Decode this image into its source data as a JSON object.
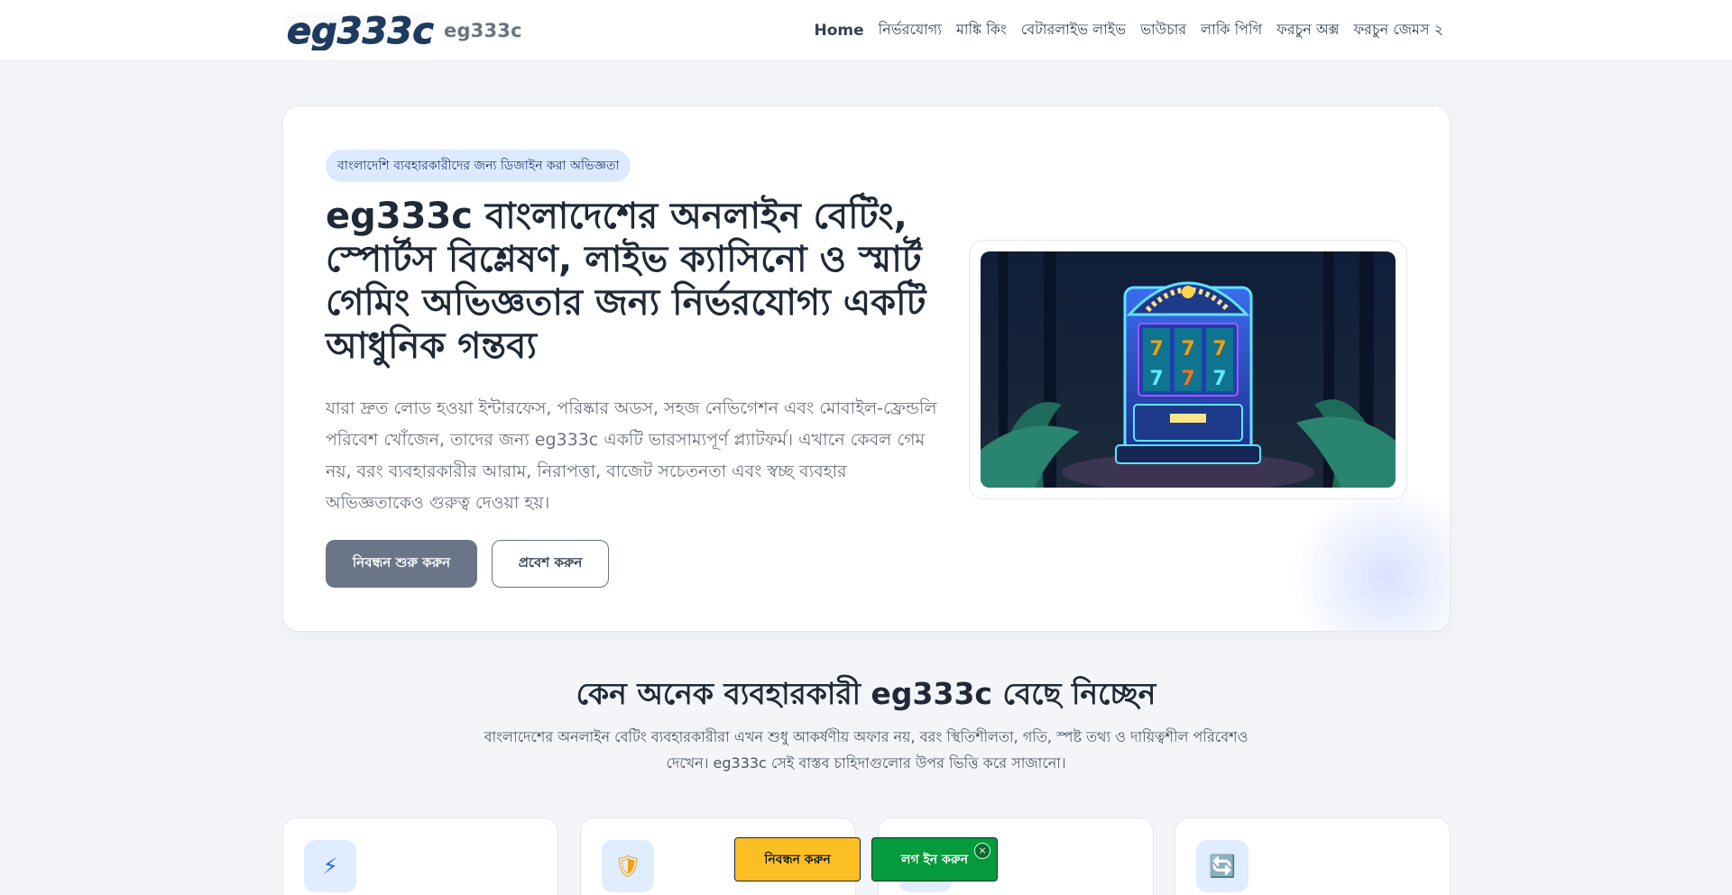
{
  "header": {
    "logo_text": "eg333c",
    "site_name": "eg333c",
    "nav": [
      {
        "label": "Home",
        "active": true
      },
      {
        "label": "নির্ভরযোগ্য"
      },
      {
        "label": "মাঙ্কি কিং"
      },
      {
        "label": "বেটারলাইভ লাইভ"
      },
      {
        "label": "ভাউচার"
      },
      {
        "label": "লাকি পিগি"
      },
      {
        "label": "ফরচুন অক্স"
      },
      {
        "label": "ফরচুন জেমস ২"
      }
    ]
  },
  "hero": {
    "badge": "বাংলাদেশি ব্যবহারকারীদের জন্য ডিজাইন করা অভিজ্ঞতা",
    "title": "eg333c বাংলাদেশের অনলাইন বেটিং, স্পোর্টস বিশ্লেষণ, লাইভ ক্যাসিনো ও স্মার্ট গেমিং অভিজ্ঞতার জন্য নির্ভরযোগ্য একটি আধুনিক গন্তব্য",
    "description": "যারা দ্রুত লোড হওয়া ইন্টারফেস, পরিষ্কার অডস, সহজ নেভিগেশন এবং মোবাইল-ফ্রেন্ডলি পরিবেশ খোঁজেন, তাদের জন্য eg333c একটি ভারসাম্যপূর্ণ প্ল্যাটফর্ম। এখানে কেবল গেম নয়, বরং ব্যবহারকারীর আরাম, নিরাপত্তা, বাজেট সচেতনতা এবং স্বচ্ছ ব্যবহার অভিজ্ঞতাকেও গুরুত্ব দেওয়া হয়।",
    "primary_button": "নিবন্ধন শুরু করুন",
    "secondary_button": "প্রবেশ করুন",
    "image_slot_number": "777"
  },
  "why": {
    "title": "কেন অনেক ব্যবহারকারী eg333c বেছে নিচ্ছেন",
    "description": "বাংলাদেশের অনলাইন বেটিং ব্যবহারকারীরা এখন শুধু আকর্ষণীয় অফার নয়, বরং স্থিতিশীলতা, গতি, স্পষ্ট তথ্য ও দায়িত্বশীল পরিবেশও দেখেন। eg333c সেই বাস্তব চাহিদাগুলোর উপর ভিত্তি করে সাজানো।"
  },
  "features": [
    {
      "icon": "lightning-icon",
      "glyph": "⚡"
    },
    {
      "icon": "shield-icon",
      "glyph": "🛡"
    },
    {
      "icon": "feature-icon",
      "glyph": ""
    },
    {
      "icon": "refresh-icon",
      "glyph": "🔄"
    }
  ],
  "floating": {
    "register": "নিবন্ধন করুন",
    "login": "লগ ইন করুন",
    "close": "×"
  }
}
